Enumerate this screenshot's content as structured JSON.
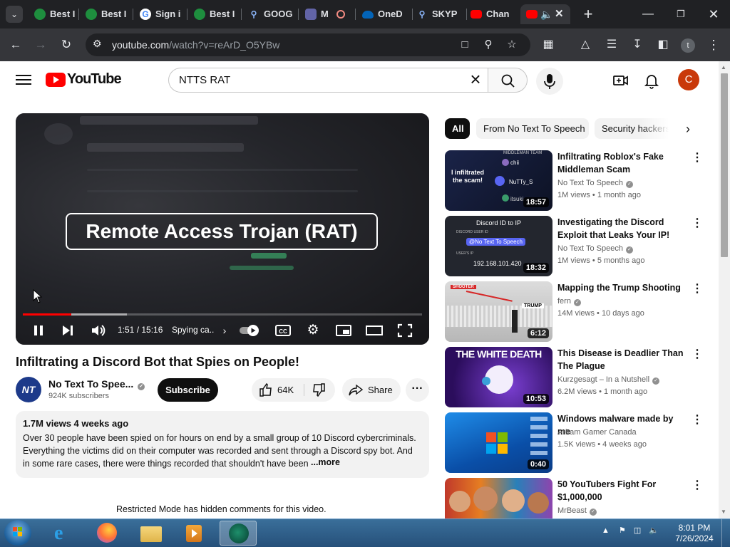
{
  "browser": {
    "tabs": [
      {
        "label": "Best I",
        "icon": "sheets-icon",
        "color": "#1e8e3e"
      },
      {
        "label": "Best I",
        "icon": "sheets-icon",
        "color": "#1e8e3e"
      },
      {
        "label": "Sign i",
        "icon": "google-icon",
        "color": "#ffffff"
      },
      {
        "label": "Best I",
        "icon": "sheets-icon",
        "color": "#1e8e3e"
      },
      {
        "label": "GOOG",
        "icon": "search-icon",
        "color": "#8ab4f8"
      },
      {
        "label": "M",
        "icon": "teams-icon",
        "color": "#6264a7"
      },
      {
        "label": "OneD",
        "icon": "onedrive-icon",
        "color": "#0364b8"
      },
      {
        "label": "SKYP",
        "icon": "search-icon",
        "color": "#8ab4f8"
      },
      {
        "label": "Chan",
        "icon": "youtube-icon",
        "color": "#ff0000"
      }
    ],
    "url_host": "youtube.com",
    "url_path": "/watch?v=reArD_O5YBw",
    "profile_initial": "t"
  },
  "youtube": {
    "logo_text": "YouTube",
    "search_value": "NTTS RAT",
    "avatar_initial": "C",
    "video": {
      "overlay_text": "Remote Access Trojan (RAT)",
      "current_time": "1:51",
      "duration": "15:16",
      "time_display": "1:51 / 15:16",
      "chapter": "Spying ca...",
      "progress_played": 0.121,
      "progress_buffered": 0.26,
      "title": "Infiltrating a Discord Bot that Spies on People!"
    },
    "channel": {
      "initials": "NT TS",
      "name": "No Text To Spee...",
      "subscribers": "924K subscribers",
      "subscribe_label": "Subscribe"
    },
    "actions": {
      "likes": "64K",
      "share_label": "Share"
    },
    "description": {
      "meta": "1.7M views  4 weeks ago",
      "text": "Over 30 people have been spied on for hours on end by a small group of 10 Discord cybercriminals. Everything the victims did on their computer was recorded and sent through a Discord spy bot. And in some rare cases, there were things recorded that shouldn't have been",
      "more_label": "...more"
    },
    "restricted_notice": "Restricted Mode has hidden comments for this video.",
    "chips": [
      "All",
      "From No Text To Speech",
      "Security hackers"
    ],
    "recommendations": [
      {
        "title": "Infiltrating Roblox's Fake Middleman Scam",
        "channel": "No Text To Speech",
        "verified": true,
        "views": "1M views",
        "age": "1 month ago",
        "duration": "18:57",
        "thumb_text": "I infiltrated the scam!",
        "thumb_labels": [
          "MIDDLEMAN TEAM",
          "chii",
          "NuTTy_S",
          "itsuki"
        ]
      },
      {
        "title": "Investigating the Discord Exploit that Leaks Your IP!",
        "channel": "No Text To Speech",
        "verified": true,
        "views": "1M views",
        "age": "5 months ago",
        "duration": "18:32",
        "thumb_text": "Discord ID to IP",
        "thumb_labels": [
          "DISCORD USER ID",
          "@No Text To Speech",
          "USER'S IP",
          "192.168.101.420"
        ]
      },
      {
        "title": "Mapping the Trump Shooting",
        "channel": "fern",
        "verified": true,
        "views": "14M views",
        "age": "10 days ago",
        "duration": "6:12",
        "thumb_text": "TRUMP",
        "thumb_labels": [
          "SHOOTER"
        ]
      },
      {
        "title": "This Disease is Deadlier Than The Plague",
        "channel": "Kurzgesagt – In a Nutshell",
        "verified": true,
        "views": "6.2M views",
        "age": "1 month ago",
        "duration": "10:53",
        "thumb_text": "THE WHITE DEATH",
        "thumb_labels": []
      },
      {
        "title": "Windows malware made by me",
        "channel": "Arham Gamer Canada",
        "verified": false,
        "views": "1.5K views",
        "age": "4 weeks ago",
        "duration": "0:40",
        "thumb_text": "",
        "thumb_labels": []
      },
      {
        "title": "50 YouTubers Fight For $1,000,000",
        "channel": "MrBeast",
        "verified": true,
        "views": "",
        "age": "",
        "duration": "",
        "thumb_text": "",
        "thumb_labels": []
      }
    ]
  },
  "taskbar": {
    "time": "8:01 PM",
    "date": "7/26/2024"
  }
}
